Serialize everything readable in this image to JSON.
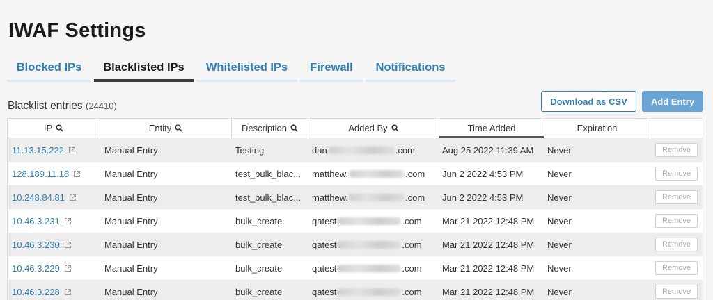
{
  "page_title": "IWAF Settings",
  "tabs": [
    {
      "label": "Blocked IPs",
      "active": false
    },
    {
      "label": "Blacklisted IPs",
      "active": true
    },
    {
      "label": "Whitelisted IPs",
      "active": false
    },
    {
      "label": "Firewall",
      "active": false
    },
    {
      "label": "Notifications",
      "active": false
    }
  ],
  "section": {
    "label": "Blacklist entries",
    "count": "(24410)"
  },
  "actions": {
    "download_csv": "Download as CSV",
    "add_entry": "Add Entry"
  },
  "columns": [
    {
      "label": "IP",
      "searchable": true
    },
    {
      "label": "Entity",
      "searchable": true
    },
    {
      "label": "Description",
      "searchable": true
    },
    {
      "label": "Added By",
      "searchable": true
    },
    {
      "label": "Time Added",
      "searchable": false,
      "sorted": true
    },
    {
      "label": "Expiration",
      "searchable": false
    },
    {
      "label": "",
      "searchable": false
    }
  ],
  "rows": [
    {
      "ip": "11.13.15.222",
      "entity": "Manual Entry",
      "description": "Testing",
      "added_by_prefix": "dan",
      "added_by_suffix": ".com",
      "time_added": "Aug 25 2022 11:39 AM",
      "expiration": "Never",
      "action": "Remove"
    },
    {
      "ip": "128.189.11.18",
      "entity": "Manual Entry",
      "description": "test_bulk_blac...",
      "added_by_prefix": "matthew.",
      "added_by_suffix": ".com",
      "time_added": "Jun 2 2022 4:53 PM",
      "expiration": "Never",
      "action": "Remove"
    },
    {
      "ip": "10.248.84.81",
      "entity": "Manual Entry",
      "description": "test_bulk_blac...",
      "added_by_prefix": "matthew.",
      "added_by_suffix": ".com",
      "time_added": "Jun 2 2022 4:53 PM",
      "expiration": "Never",
      "action": "Remove"
    },
    {
      "ip": "10.46.3.231",
      "entity": "Manual Entry",
      "description": "bulk_create",
      "added_by_prefix": "qatest",
      "added_by_suffix": ".com",
      "time_added": "Mar 21 2022 12:48 PM",
      "expiration": "Never",
      "action": "Remove"
    },
    {
      "ip": "10.46.3.230",
      "entity": "Manual Entry",
      "description": "bulk_create",
      "added_by_prefix": "qatest",
      "added_by_suffix": ".com",
      "time_added": "Mar 21 2022 12:48 PM",
      "expiration": "Never",
      "action": "Remove"
    },
    {
      "ip": "10.46.3.229",
      "entity": "Manual Entry",
      "description": "bulk_create",
      "added_by_prefix": "qatest",
      "added_by_suffix": ".com",
      "time_added": "Mar 21 2022 12:48 PM",
      "expiration": "Never",
      "action": "Remove"
    },
    {
      "ip": "10.46.3.228",
      "entity": "Manual Entry",
      "description": "bulk_create",
      "added_by_prefix": "qatest",
      "added_by_suffix": ".com",
      "time_added": "Mar 21 2022 12:48 PM",
      "expiration": "Never",
      "action": "Remove"
    }
  ],
  "icons": {
    "search": "magnifier-icon",
    "external": "external-link-icon"
  },
  "colors": {
    "link": "#2f7fb3",
    "primary_button": "#6aa5d3",
    "active_tab_underline": "#3a3a3a"
  }
}
